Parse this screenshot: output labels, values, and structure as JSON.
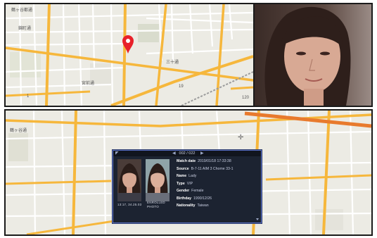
{
  "top_map": {
    "labels": [
      "鶴ヶ谷都通",
      "宮前通",
      "錦町通",
      "三十通",
      "19",
      "120",
      "1"
    ]
  },
  "bottom_map": {
    "labels": [
      "鶴ヶ谷通"
    ]
  },
  "popup": {
    "page_indicator": "002 / 022",
    "snapshot_caption": "13:17, 34.25.03",
    "enrolled_caption_line1": "ENROLLED",
    "enrolled_caption_line2": "PHOTO",
    "fields": [
      {
        "key": "Match date",
        "value": "2019/01/18  17:33:38"
      },
      {
        "key": "Source",
        "value": "B-7-11 AIM 3 Chome 33-1"
      },
      {
        "key": "Name",
        "value": "Lady"
      },
      {
        "key": "Type",
        "value": "VIP"
      },
      {
        "key": "Gender",
        "value": "Female"
      },
      {
        "key": "Birthday",
        "value": "1990/12/26"
      },
      {
        "key": "Nationality",
        "value": "Taiwan"
      }
    ]
  },
  "colors": {
    "road_major": "#f6b73c",
    "road_minor": "#ffffff",
    "pin": "#e8202a",
    "popup_border": "#5d74c8"
  }
}
